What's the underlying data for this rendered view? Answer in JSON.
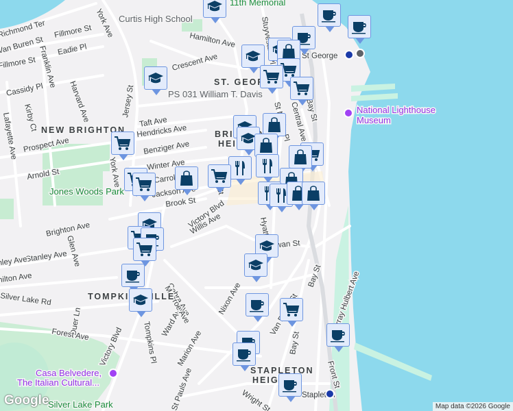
{
  "colors": {
    "water": "#8dd9ed",
    "park": "#c7ecd2",
    "road": "#ffffff",
    "marker_fill": "#e3ebfb",
    "marker_border": "#6d95e0",
    "icon": "#0b3f66"
  },
  "neighborhoods": [
    "NEW BRIGHTON",
    "ST. GEORGE",
    "BRIGHTON",
    "HEIGHTS",
    "TOMPKINSVILLE",
    "STAPLETON",
    "HEIGHTS"
  ],
  "streets": [
    "Richmond Ter",
    "Van Buren St",
    "Fillmore St",
    "Fillmore St",
    "Eadie Pl",
    "Franklin Ave",
    "York Ave",
    "Hamilton Ave",
    "Crescent Ave",
    "Cassidy Pl",
    "Harvard Ave",
    "Kirby Ct",
    "Lafayette Ave",
    "Jersey St",
    "Taft Ave",
    "Hendricks Ave",
    "Prospect Ave",
    "Benziger Ave",
    "Arnold St",
    "York Ave",
    "Winter Ave",
    "Carroll Ave",
    "Jackson Ave",
    "Brook St",
    "Victory Blvd",
    "Willis Ave",
    "Wall St",
    "Central Ave",
    "Bay St",
    "St Marks Pl",
    "Stuyvesant Pl",
    "Brighton Ave",
    "Stanley Ave",
    "Glen Ave",
    "Stanley Ave",
    "Hamilton Ave",
    "Silver Lake Rd",
    "Duer Ln",
    "Forest Ave",
    "Victory Blvd",
    "Cebra Ave",
    "Ward Ave",
    "Nixon Ave",
    "Marion Ave",
    "St Pauls Ave",
    "Van Duzer St",
    "Bay St",
    "Bay St",
    "Murray Hulbert Ave",
    "Front St",
    "Wright St",
    "Swan St",
    "Hyatt St",
    "Monroe Ave",
    "Tompkins Pl"
  ],
  "parks": [
    "Jones Woods Park",
    "Silver Lake Park"
  ],
  "places": {
    "school1": "Curtis High School",
    "school2": "PS 031 William T. Davis",
    "memorial": "11th Memorial",
    "museum_l1": "National Lighthouse",
    "museum_l2": "Museum",
    "casa_l1": "Casa Belvedere,",
    "casa_l2": "The Italian Cultural...",
    "station1": "St George",
    "station2": "Stapleton"
  },
  "markers": [
    "education",
    "cafe",
    "cafe",
    "cafe",
    "education",
    "education",
    "shopping",
    "grocery",
    "grocery",
    "grocery",
    "education",
    "education",
    "shopping",
    "education",
    "shopping",
    "grocery",
    "shopping",
    "restaurant",
    "restaurant",
    "grocery",
    "shopping",
    "grocery",
    "grocery",
    "grocery",
    "shopping",
    "restaurant",
    "restaurant",
    "shopping",
    "shopping",
    "education",
    "grocery",
    "cafe",
    "grocery",
    "cafe",
    "education",
    "education",
    "education",
    "cafe",
    "grocery",
    "cafe",
    "cafe",
    "cafe",
    "cafe"
  ],
  "footer": {
    "logo": "Google",
    "attribution": "Map data ©2026 Google"
  }
}
